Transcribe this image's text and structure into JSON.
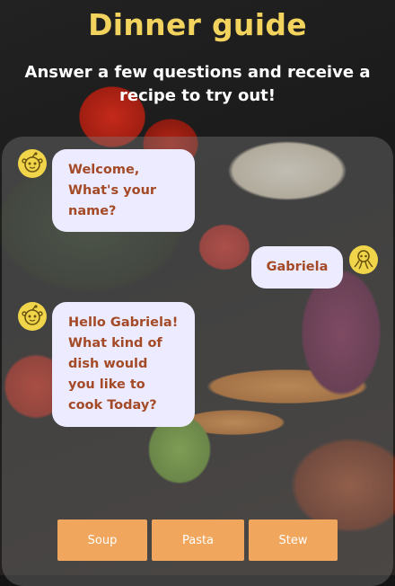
{
  "header": {
    "title": "Dinner guide",
    "subtitle": "Answer a few questions and receive a recipe to try out!"
  },
  "chat": {
    "messages": [
      {
        "sender": "bot",
        "text": "Welcome, What's your name?",
        "avatar_icon": "bot-face-icon"
      },
      {
        "sender": "user",
        "text": "Gabriela",
        "avatar_icon": "octopus-icon"
      },
      {
        "sender": "bot",
        "text": "Hello Gabriela! What kind of dish would you like to cook Today?",
        "avatar_icon": "bot-face-icon"
      }
    ]
  },
  "options": [
    "Soup",
    "Pasta",
    "Stew"
  ],
  "colors": {
    "title": "#f2d35e",
    "bubble": "#ecebff",
    "bubble_text": "#a44a27",
    "option_button": "#f0a65c",
    "avatar": "#f0d54a"
  }
}
